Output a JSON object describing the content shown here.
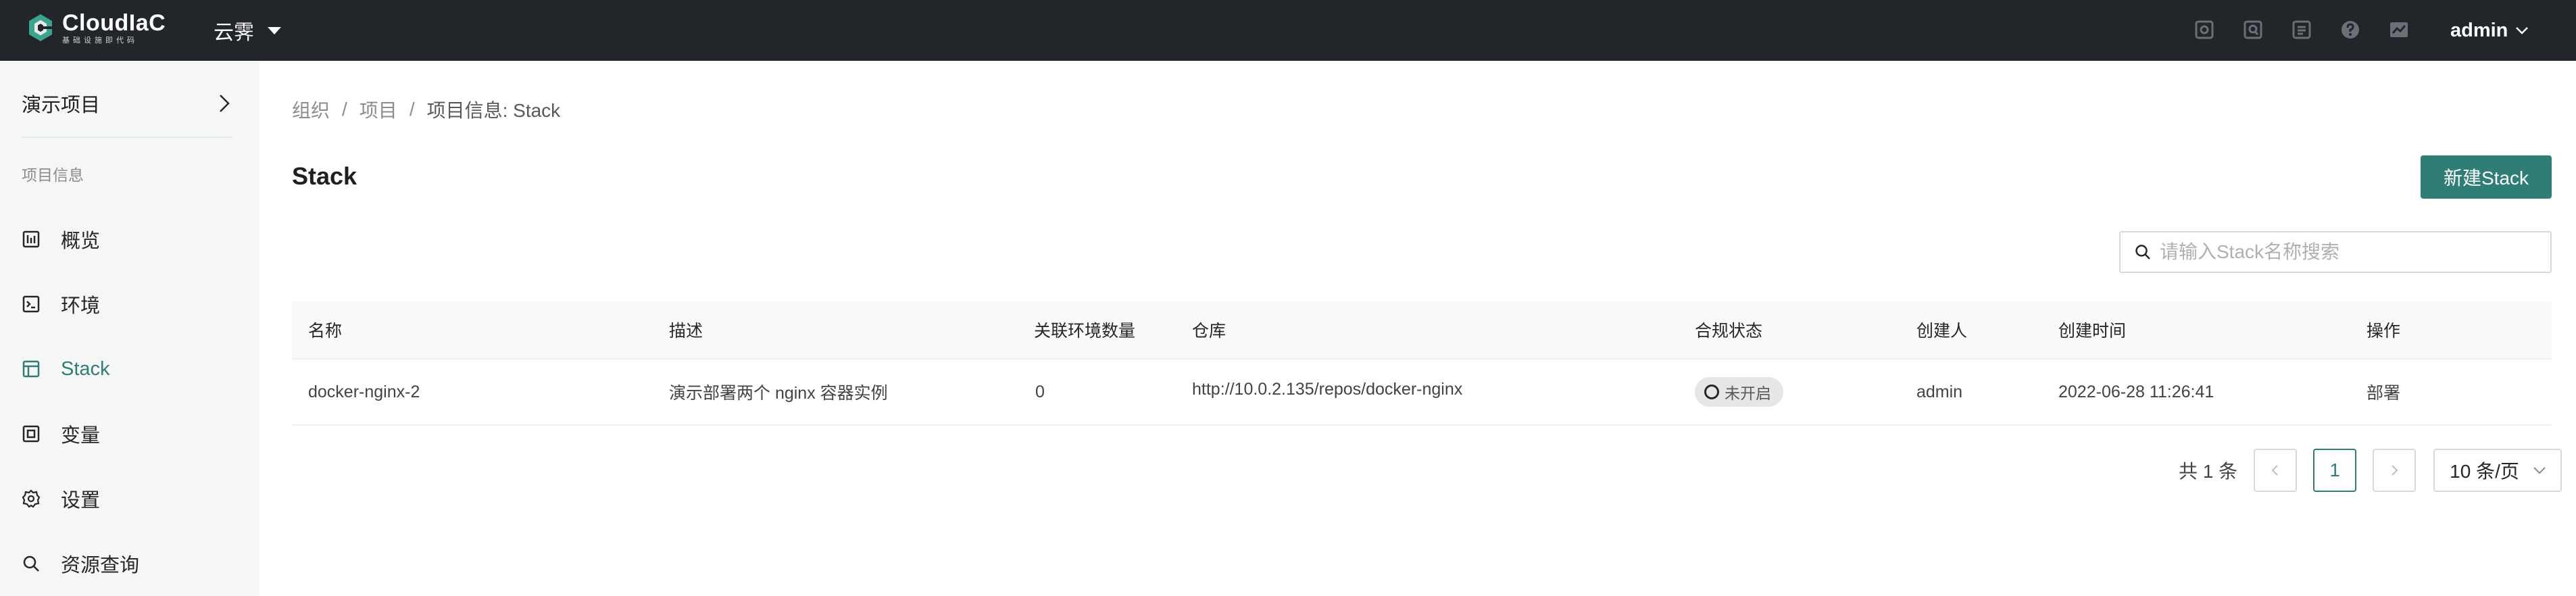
{
  "topbar": {
    "logo_name": "CloudIaC",
    "logo_sub": "基础设施即代码",
    "org_name": "云霁",
    "user_name": "admin",
    "icons": [
      "settings-icon",
      "audit-icon",
      "document-icon",
      "help-icon",
      "chart-icon"
    ]
  },
  "sidebar": {
    "project_name": "演示项目",
    "section_label": "项目信息",
    "items": [
      {
        "label": "概览",
        "icon": "overview-icon",
        "active": false
      },
      {
        "label": "环境",
        "icon": "terminal-icon",
        "active": false
      },
      {
        "label": "Stack",
        "icon": "stack-icon",
        "active": true
      },
      {
        "label": "变量",
        "icon": "variable-icon",
        "active": false
      },
      {
        "label": "设置",
        "icon": "gear-icon",
        "active": false
      },
      {
        "label": "资源查询",
        "icon": "search-icon",
        "active": false
      }
    ]
  },
  "breadcrumb": {
    "items": [
      "组织",
      "项目"
    ],
    "current": "项目信息: Stack",
    "separator": "/"
  },
  "page": {
    "title": "Stack",
    "new_button_label": "新建Stack",
    "search_placeholder": "请输入Stack名称搜索"
  },
  "table": {
    "columns": [
      "名称",
      "描述",
      "关联环境数量",
      "仓库",
      "合规状态",
      "创建人",
      "创建时间",
      "操作"
    ],
    "rows": [
      {
        "name": "docker-nginx-2",
        "description": "演示部署两个 nginx 容器实例",
        "env_count": "0",
        "repo": "http://10.0.2.135/repos/docker-nginx",
        "compliance": "未开启",
        "creator": "admin",
        "created_at": "2022-06-28 11:26:41",
        "action": "部署"
      }
    ]
  },
  "pagination": {
    "total_text": "共 1 条",
    "current_page": "1",
    "page_size": "10 条/页"
  },
  "colors": {
    "accent": "#2f7e75",
    "topbar_bg": "#22262b",
    "sidebar_bg": "#f5f6f6"
  }
}
